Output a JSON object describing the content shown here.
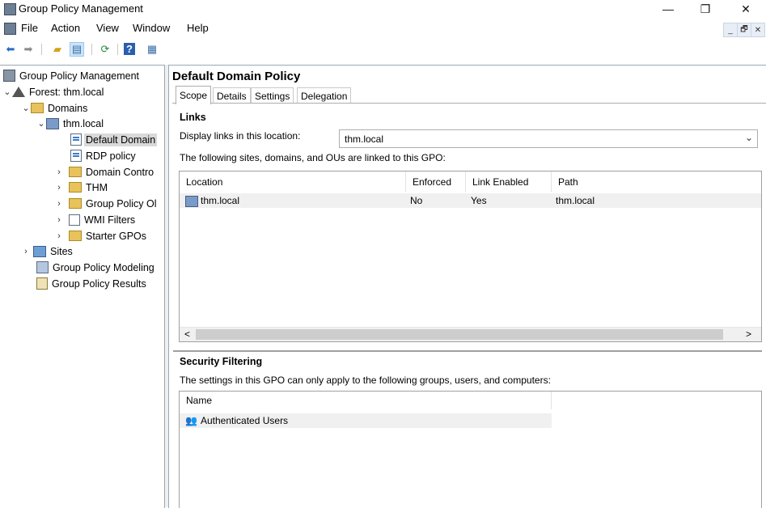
{
  "window": {
    "title": "Group Policy Management",
    "controls": {
      "minimize": "—",
      "restore": "❐",
      "close": "✕"
    }
  },
  "menubar": {
    "items": [
      "File",
      "Action",
      "View",
      "Window",
      "Help"
    ],
    "mdi_controls": {
      "minimize": "_",
      "restore": "🗗",
      "close": "✕"
    }
  },
  "toolbar": {
    "icons": [
      "back-arrow-icon",
      "forward-arrow-icon",
      "up-folder-icon",
      "show-hide-console-tree-icon",
      "refresh-icon",
      "help-icon",
      "properties-icon"
    ]
  },
  "tree": {
    "items": [
      {
        "label": "Group Policy Management",
        "icon": "gpmc-icon"
      },
      {
        "label": "Forest: thm.local",
        "icon": "forest-icon"
      },
      {
        "label": "Domains",
        "icon": "domains-folder-icon"
      },
      {
        "label": "thm.local",
        "icon": "domain-icon"
      },
      {
        "label": "Default Domain",
        "icon": "gpo-link-icon"
      },
      {
        "label": "RDP policy",
        "icon": "gpo-link-icon"
      },
      {
        "label": "Domain Contro",
        "icon": "ou-folder-icon"
      },
      {
        "label": "THM",
        "icon": "ou-folder-icon"
      },
      {
        "label": "Group Policy Ol",
        "icon": "gpo-folder-icon"
      },
      {
        "label": "WMI Filters",
        "icon": "wmi-filter-icon"
      },
      {
        "label": "Starter GPOs",
        "icon": "starter-gpo-icon"
      },
      {
        "label": "Sites",
        "icon": "sites-icon"
      },
      {
        "label": "Group Policy Modeling",
        "icon": "modeling-icon"
      },
      {
        "label": "Group Policy Results",
        "icon": "results-icon"
      }
    ]
  },
  "main": {
    "title": "Default Domain Policy",
    "tabs": [
      "Scope",
      "Details",
      "Settings",
      "Delegation"
    ],
    "active_tab": "Scope",
    "links": {
      "section_title": "Links",
      "display_label": "Display links in this location:",
      "location_value": "thm.local",
      "description": "The following sites, domains, and OUs are linked to this GPO:",
      "columns": [
        "Location",
        "Enforced",
        "Link Enabled",
        "Path"
      ],
      "rows": [
        {
          "location": "thm.local",
          "enforced": "No",
          "link_enabled": "Yes",
          "path": "thm.local"
        }
      ],
      "scroll_left": "<",
      "scroll_right": ">"
    },
    "security_filtering": {
      "section_title": "Security Filtering",
      "description": "The settings in this GPO can only apply to the following groups, users, and computers:",
      "columns": [
        "Name"
      ],
      "rows": [
        {
          "name": "Authenticated Users"
        }
      ]
    }
  },
  "colors": {
    "selection": "#d9d9d9",
    "pane_border": "#9aa7b5",
    "row_highlight": "#f0f0f0"
  }
}
